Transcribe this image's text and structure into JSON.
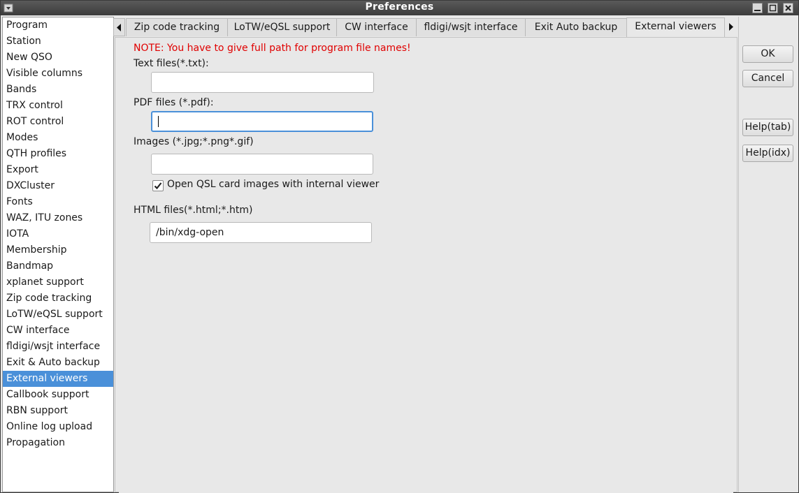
{
  "window": {
    "title": "Preferences"
  },
  "sidebar": {
    "items": [
      {
        "label": "Program"
      },
      {
        "label": "Station"
      },
      {
        "label": "New QSO"
      },
      {
        "label": "Visible columns"
      },
      {
        "label": "Bands"
      },
      {
        "label": "TRX control"
      },
      {
        "label": "ROT control"
      },
      {
        "label": "Modes"
      },
      {
        "label": "QTH profiles"
      },
      {
        "label": "Export"
      },
      {
        "label": "DXCluster"
      },
      {
        "label": "Fonts"
      },
      {
        "label": "WAZ, ITU zones"
      },
      {
        "label": "IOTA"
      },
      {
        "label": "Membership"
      },
      {
        "label": "Bandmap"
      },
      {
        "label": "xplanet support"
      },
      {
        "label": "Zip code tracking"
      },
      {
        "label": "LoTW/eQSL support"
      },
      {
        "label": "CW interface"
      },
      {
        "label": "fldigi/wsjt interface"
      },
      {
        "label": "Exit & Auto backup"
      },
      {
        "label": "External viewers",
        "selected": true
      },
      {
        "label": "Callbook support"
      },
      {
        "label": "RBN support"
      },
      {
        "label": "Online log upload"
      },
      {
        "label": "Propagation"
      }
    ]
  },
  "tabs": [
    {
      "label": "Zip code tracking"
    },
    {
      "label": "LoTW/eQSL support"
    },
    {
      "label": "CW interface"
    },
    {
      "label": "fldigi/wsjt interface"
    },
    {
      "label": "Exit  Auto backup"
    },
    {
      "label": "External viewers",
      "active": true
    }
  ],
  "external_viewers": {
    "note": "NOTE: You have to give full path for program file names!",
    "text_files_label": "Text files(*.txt):",
    "text_files_value": "",
    "pdf_files_label": "PDF files (*.pdf):",
    "pdf_files_value": "",
    "images_label": "Images (*.jpg;*.png*.gif)",
    "images_value": "",
    "open_qsl_internal_label": "Open QSL card images with internal viewer",
    "open_qsl_internal_checked": true,
    "html_files_label": "HTML files(*.html;*.htm)",
    "html_files_value": "/bin/xdg-open"
  },
  "buttons": {
    "ok": "OK",
    "cancel": "Cancel",
    "help_tab": "Help(tab)",
    "help_idx": "Help(idx)"
  },
  "colors": {
    "accent": "#4a90d9",
    "note": "#e00000",
    "titlebar": "#3c3c3c"
  }
}
